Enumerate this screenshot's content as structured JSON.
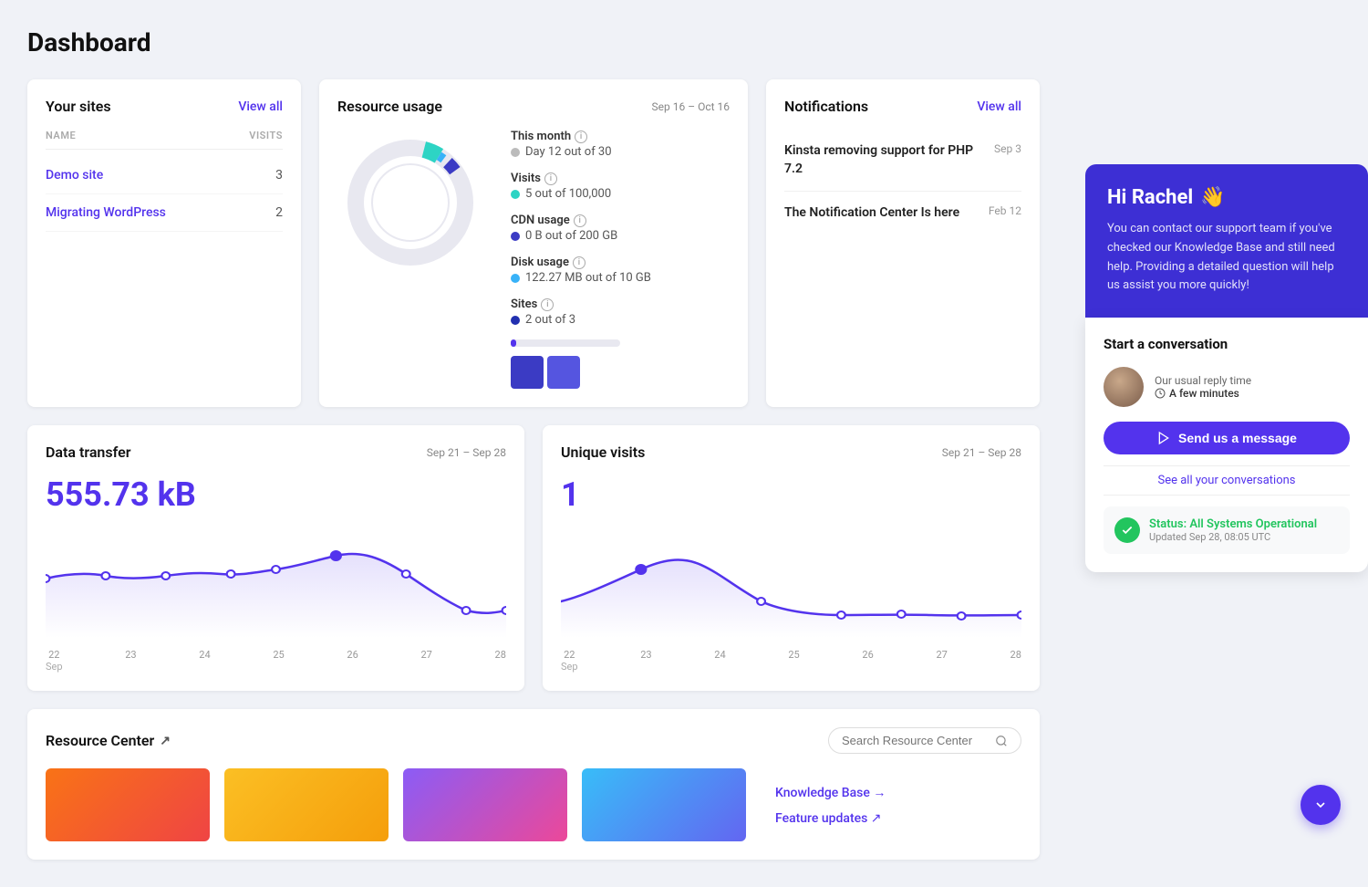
{
  "page": {
    "title": "Dashboard"
  },
  "your_sites": {
    "title": "Your sites",
    "view_all": "View all",
    "columns": {
      "name": "NAME",
      "visits": "VISITS"
    },
    "sites": [
      {
        "name": "Demo site",
        "visits": "3"
      },
      {
        "name": "Migrating WordPress",
        "visits": "2"
      }
    ]
  },
  "resource_usage": {
    "title": "Resource usage",
    "date_range": "Sep 16 – Oct 16",
    "stats": [
      {
        "label": "This month",
        "value": "Day 12 out of 30",
        "dot_color": "gray"
      },
      {
        "label": "Visits",
        "value": "5 out of 100,000",
        "dot_color": "teal"
      },
      {
        "label": "CDN usage",
        "value": "0 B out of 200 GB",
        "dot_color": "blue"
      },
      {
        "label": "Disk usage",
        "value": "122.27 MB out of 10 GB",
        "dot_color": "lightblue"
      },
      {
        "label": "Sites",
        "value": "2 out of 3",
        "dot_color": "darkblue"
      }
    ]
  },
  "notifications": {
    "title": "Notifications",
    "view_all": "View all",
    "items": [
      {
        "title": "Kinsta removing support for PHP 7.2",
        "date": "Sep 3"
      },
      {
        "title": "The Notification Center Is here",
        "date": "Feb 12"
      }
    ]
  },
  "data_transfer": {
    "title": "Data transfer",
    "date_range": "Sep 21 – Sep 28",
    "value": "555.73 kB",
    "labels": [
      "22",
      "23",
      "24",
      "25",
      "26",
      "27",
      "28"
    ],
    "sub_label": "Sep"
  },
  "unique_visits": {
    "title": "Unique visits",
    "date_range": "Sep 21 – Sep 28",
    "value": "1",
    "labels": [
      "22",
      "23",
      "24",
      "25",
      "26",
      "27",
      "28"
    ],
    "sub_label": "Sep"
  },
  "resource_center": {
    "title": "Resource Center",
    "search_placeholder": "Search Resource Center",
    "external_link": "↗",
    "links": [
      {
        "label": "Knowledge Base →"
      },
      {
        "label": "Feature updates ↗"
      }
    ]
  },
  "support_panel": {
    "greeting": "Hi Rachel",
    "wave": "👋",
    "description": "You can contact our support team if you've checked our Knowledge Base and still need help. Providing a detailed question will help us assist you more quickly!",
    "conversation": {
      "title": "Start a conversation",
      "reply_label": "Our usual reply time",
      "reply_time": "A few minutes",
      "send_button": "Send us a message",
      "see_all": "See all your conversations"
    },
    "status": {
      "label": "Status: All Systems Operational",
      "updated": "Updated Sep 28, 08:05 UTC"
    }
  }
}
